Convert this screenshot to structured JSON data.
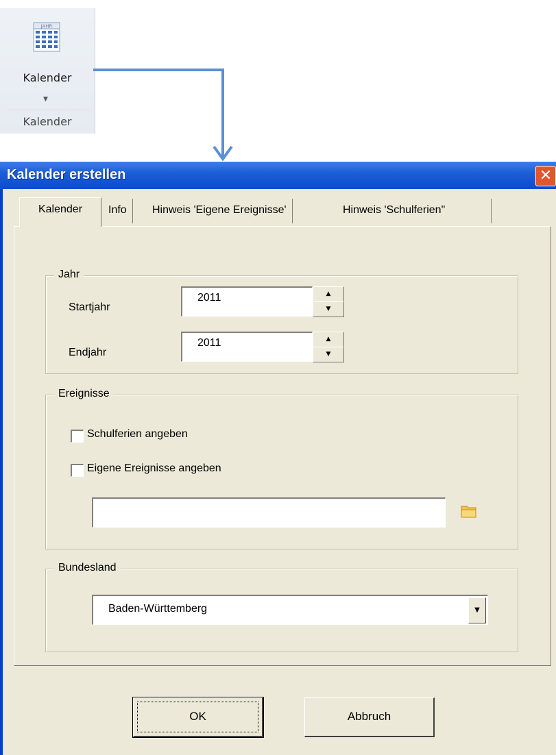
{
  "ribbon": {
    "button_label": "Kalender",
    "group_label": "Kalender",
    "icon_caption": "JAHR"
  },
  "dialog": {
    "title": "Kalender erstellen",
    "close_symbol": "✕",
    "tabs": [
      {
        "label": "Kalender",
        "active": true
      },
      {
        "label": "Info",
        "active": false
      },
      {
        "label": "Hinweis 'Eigene Ereignisse'",
        "active": false
      },
      {
        "label": "Hinweis 'Schulferien\"",
        "active": false
      }
    ],
    "jahr": {
      "legend": "Jahr",
      "startjahr_label": "Startjahr",
      "startjahr_value": "2011",
      "endjahr_label": "Endjahr",
      "endjahr_value": "2011"
    },
    "ereignisse": {
      "legend": "Ereignisse",
      "schulferien_label": "Schulferien angeben",
      "schulferien_checked": false,
      "eigene_label": "Eigene Ereignisse angeben",
      "eigene_checked": false,
      "file_path_value": ""
    },
    "bundesland": {
      "legend": "Bundesland",
      "selected": "Baden-Württemberg"
    },
    "buttons": {
      "ok": "OK",
      "cancel": "Abbruch"
    }
  },
  "colors": {
    "titlebar": "#0b4ad0",
    "dialog_face": "#ece9d8",
    "connector_arrow": "#5b8fd8",
    "close_button": "#e0562f"
  }
}
